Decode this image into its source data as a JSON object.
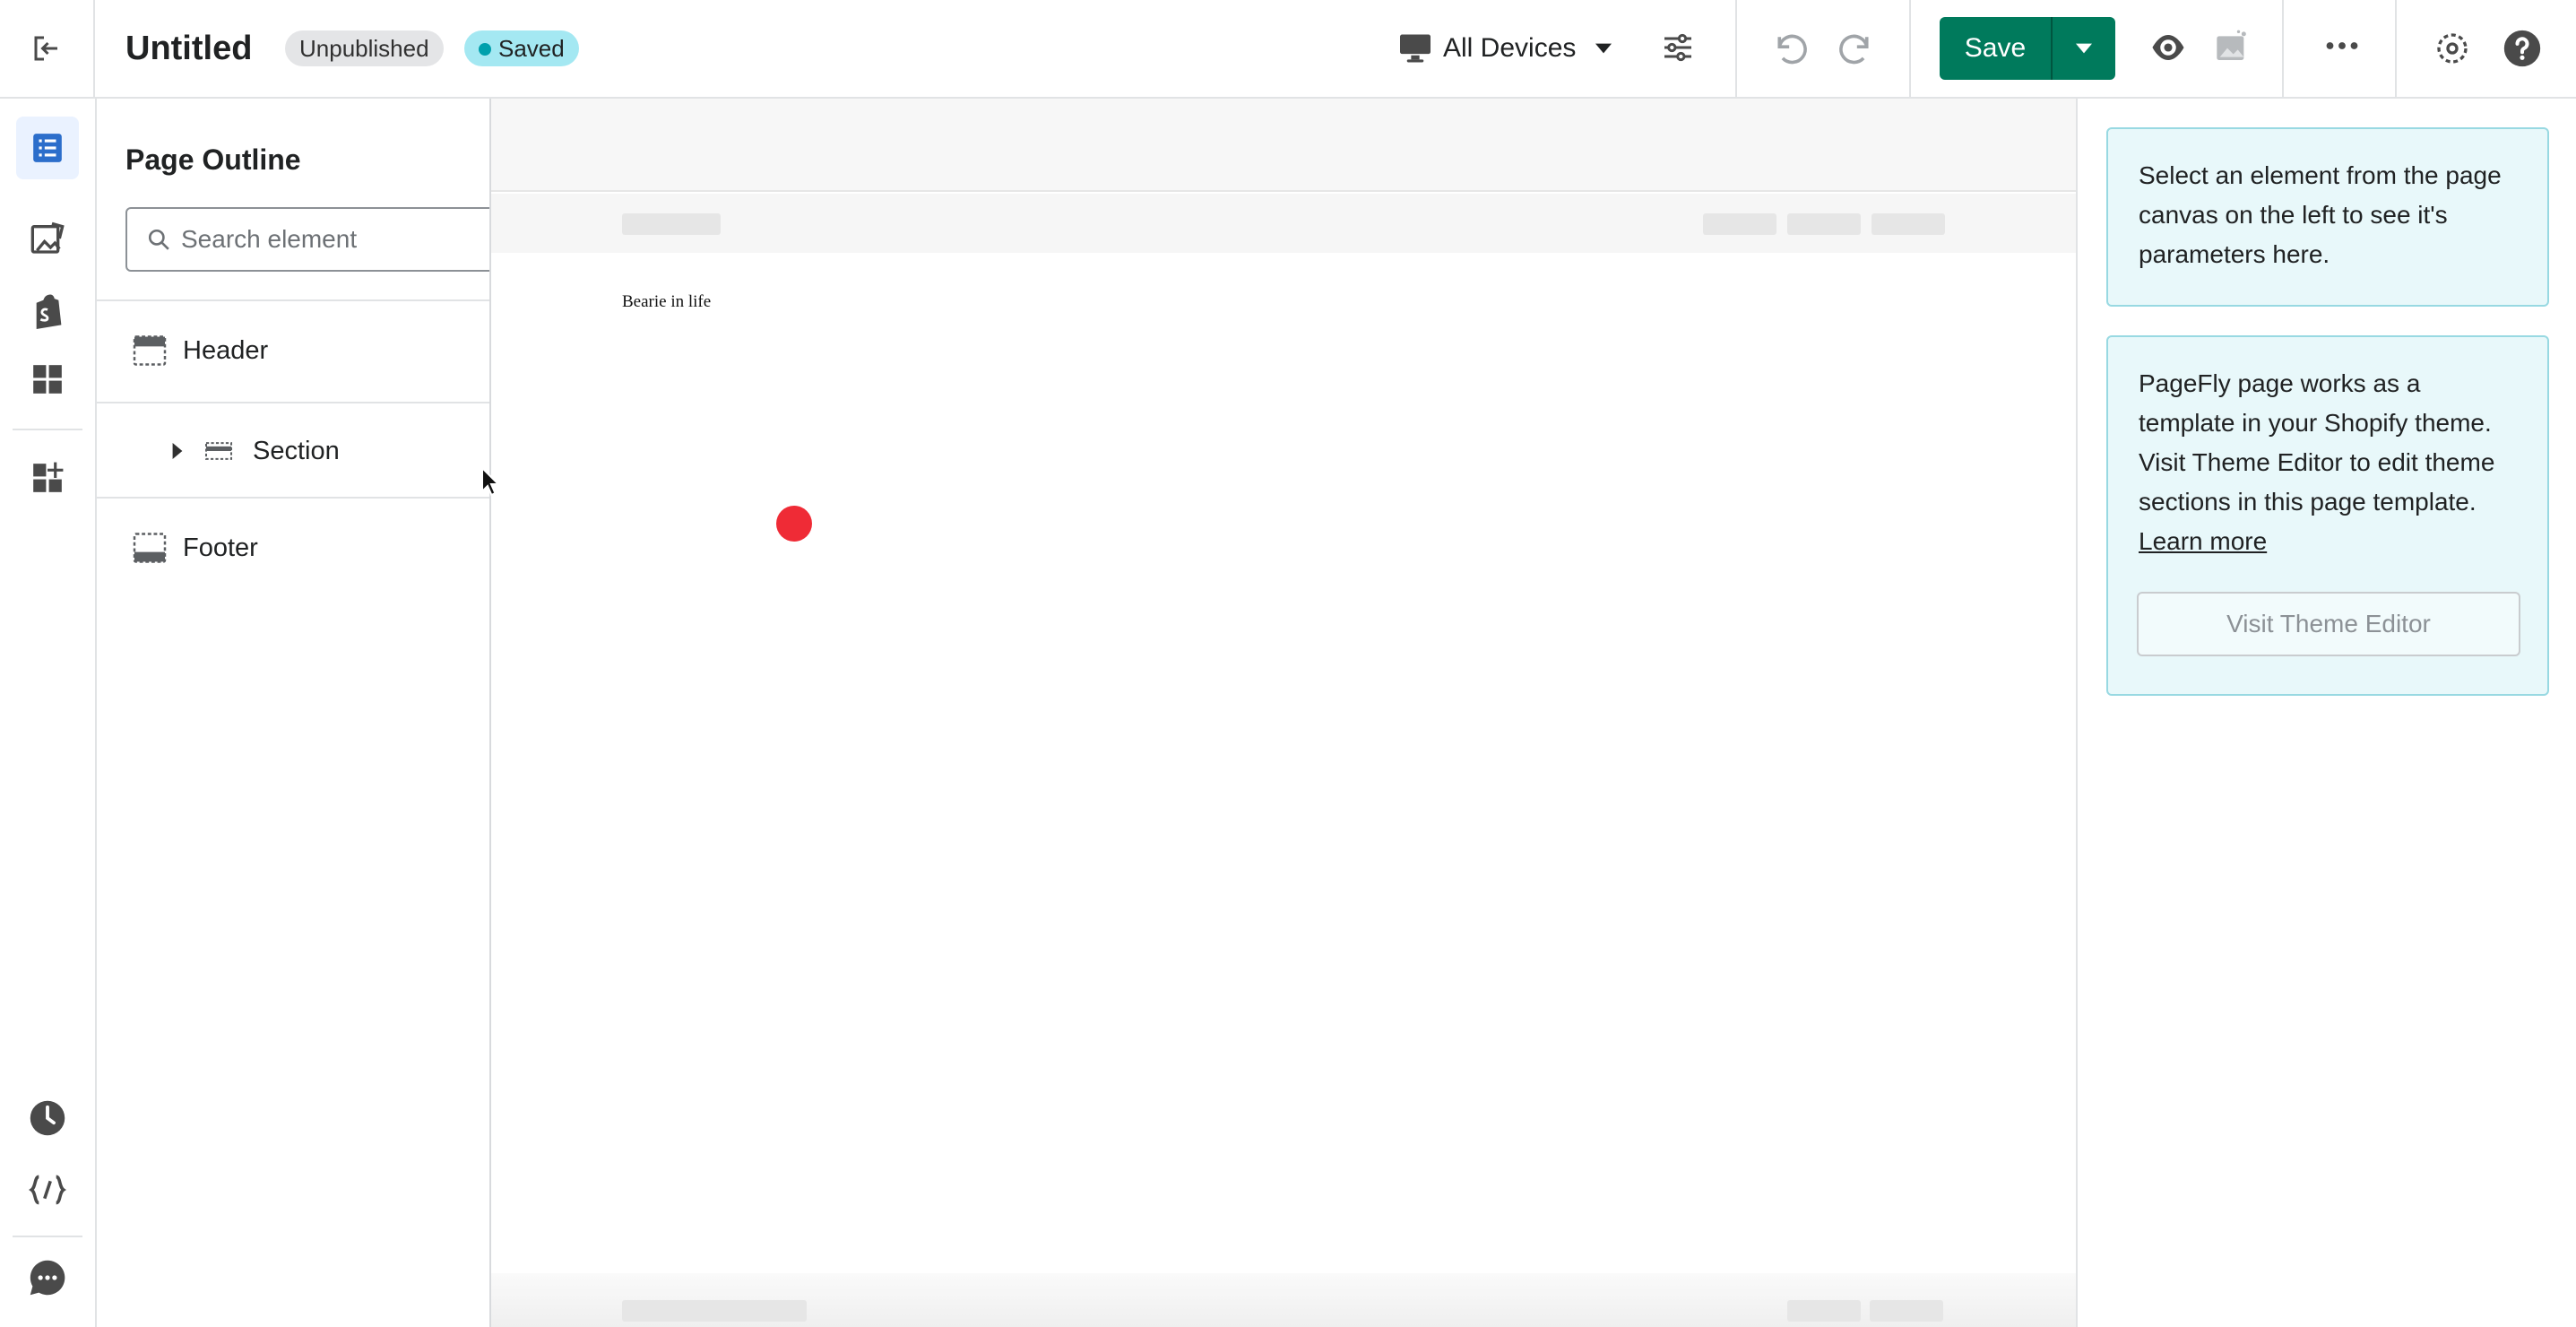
{
  "topbar": {
    "title": "Untitled",
    "status_badge": "Unpublished",
    "saved_badge": "Saved",
    "device_selector": "All Devices",
    "save_label": "Save"
  },
  "outline": {
    "title": "Page Outline",
    "search_placeholder": "Search element",
    "items": [
      {
        "label": "Header",
        "icon": "header-layout-icon"
      },
      {
        "label": "Section",
        "icon": "section-layout-icon",
        "collapsed": true
      },
      {
        "label": "Footer",
        "icon": "footer-layout-icon"
      }
    ]
  },
  "canvas": {
    "text": "Bearie in life"
  },
  "right_panel": {
    "card1_text": "Select an element from the page canvas on the left to see it's parameters here.",
    "card2_text": "PageFly page works as a template in your Shopify theme. Visit Theme Editor to edit theme sections in this page template.",
    "card2_link": "Learn more",
    "card2_button": "Visit Theme Editor"
  },
  "rail": {
    "icons": [
      "page-outline-icon",
      "media-icon",
      "shopify-icon",
      "elements-grid-icon",
      "add-element-icon",
      "history-icon",
      "code-icon",
      "chat-icon"
    ]
  },
  "colors": {
    "primary_save": "#007a5c",
    "saved_badge": "#a4e8f2",
    "info_card_bg": "#e8f8fa",
    "active_rail": "#2c6ecb"
  }
}
